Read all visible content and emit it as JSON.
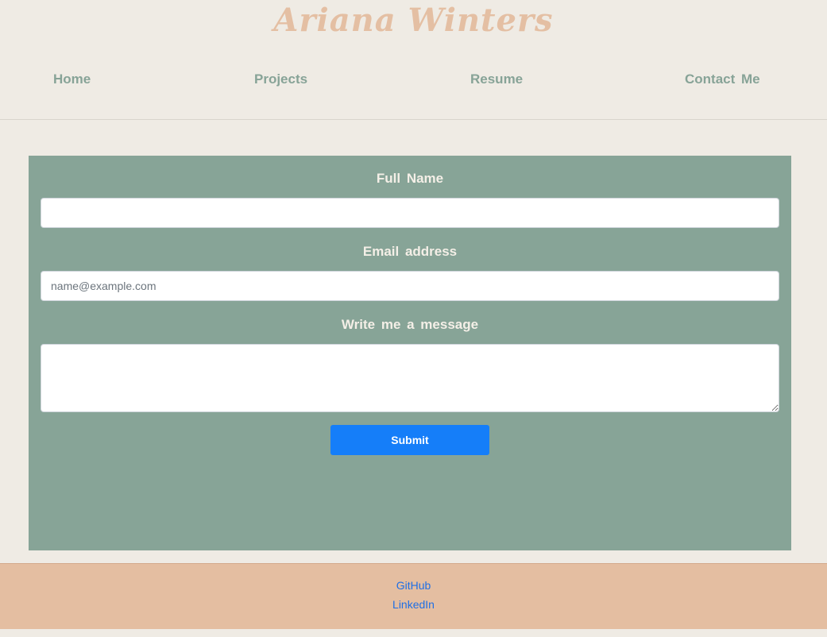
{
  "header": {
    "title": "Ariana Winters"
  },
  "nav": {
    "items": [
      {
        "label": "Home"
      },
      {
        "label": "Projects"
      },
      {
        "label": "Resume"
      },
      {
        "label": "Contact Me"
      }
    ]
  },
  "form": {
    "full_name": {
      "label": "Full Name",
      "value": "",
      "placeholder": ""
    },
    "email": {
      "label": "Email address",
      "value": "",
      "placeholder": "name@example.com"
    },
    "message": {
      "label": "Write me a message",
      "value": "",
      "placeholder": ""
    },
    "submit_label": "Submit"
  },
  "footer": {
    "links": [
      {
        "label": "GitHub"
      },
      {
        "label": "LinkedIn"
      }
    ]
  },
  "colors": {
    "background": "#efebe4",
    "title_accent": "#e4bfa3",
    "nav_text": "#87a397",
    "panel": "#87a497",
    "button": "#157ef9",
    "footer": "#e4bea1",
    "link": "#1f6fe5"
  }
}
